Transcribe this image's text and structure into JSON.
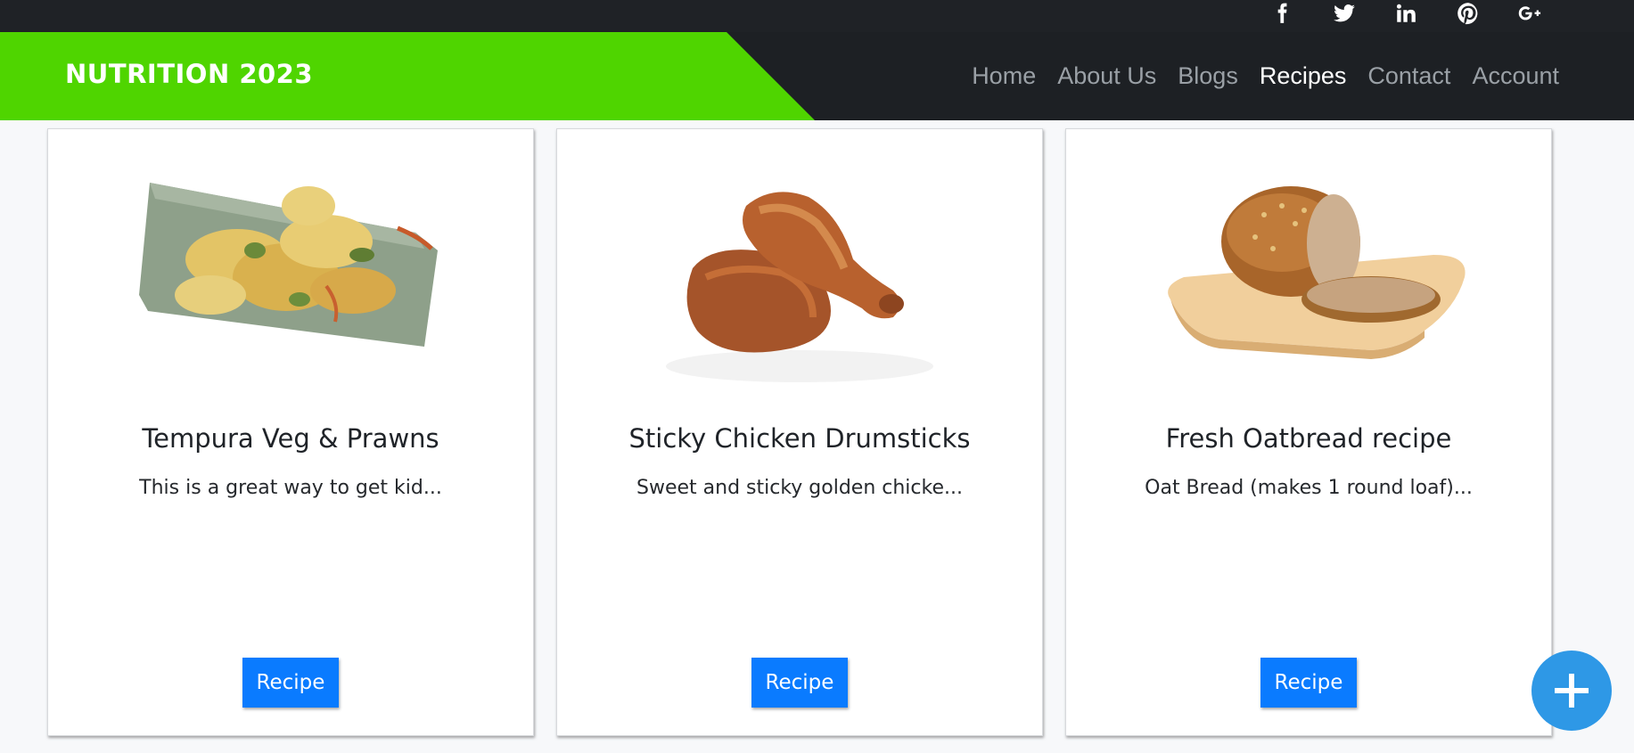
{
  "social": {
    "icons": [
      "facebook-icon",
      "twitter-icon",
      "linkedin-icon",
      "pinterest-icon",
      "google-plus-icon"
    ],
    "icon_color": "#ffffff"
  },
  "header": {
    "brand": "NUTRITION 2023",
    "brand_color": "#4fd500",
    "nav": [
      {
        "label": "Home",
        "active": false
      },
      {
        "label": "About Us",
        "active": false
      },
      {
        "label": "Blogs",
        "active": false
      },
      {
        "label": "Recipes",
        "active": true
      },
      {
        "label": "Contact",
        "active": false
      },
      {
        "label": "Account",
        "active": false
      }
    ]
  },
  "cards": [
    {
      "title": "Tempura Veg & Prawns",
      "description": "This is a great way to get kid...",
      "button": "Recipe",
      "image": "tempura-photo"
    },
    {
      "title": "Sticky Chicken Drumsticks",
      "description": "Sweet and sticky golden chicke...",
      "button": "Recipe",
      "image": "chicken-drumsticks-photo"
    },
    {
      "title": "Fresh Oatbread recipe",
      "description": "Oat Bread (makes 1 round loaf)...",
      "button": "Recipe",
      "image": "oatbread-photo"
    }
  ],
  "colors": {
    "accent": "#0a7bff",
    "fab": "#2e98e6",
    "dark_bg": "#1d2024"
  },
  "fab": {
    "icon": "plus-icon"
  }
}
